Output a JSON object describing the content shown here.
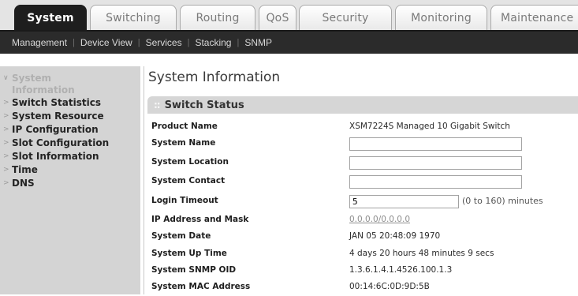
{
  "top_tabs": [
    {
      "label": "System",
      "active": true
    },
    {
      "label": "Switching",
      "active": false
    },
    {
      "label": "Routing",
      "active": false
    },
    {
      "label": "QoS",
      "active": false
    },
    {
      "label": "Security",
      "active": false
    },
    {
      "label": "Monitoring",
      "active": false
    },
    {
      "label": "Maintenance",
      "active": false
    }
  ],
  "sub_nav": [
    "Management",
    "Device View",
    "Services",
    "Stacking",
    "SNMP"
  ],
  "sidebar": {
    "items": [
      {
        "label": "System Information",
        "active": true
      },
      {
        "label": "Switch Statistics"
      },
      {
        "label": "System Resource"
      },
      {
        "label": "IP Configuration"
      },
      {
        "label": "Slot Configuration"
      },
      {
        "label": "Slot Information"
      },
      {
        "label": "Time"
      },
      {
        "label": "DNS"
      }
    ]
  },
  "page_title": "System Information",
  "section_title": "Switch Status",
  "fields": {
    "product_name": {
      "label": "Product Name",
      "value": "XSM7224S  Managed 10 Gigabit Switch"
    },
    "system_name": {
      "label": "System Name",
      "value": ""
    },
    "system_location": {
      "label": "System Location",
      "value": ""
    },
    "system_contact": {
      "label": "System Contact",
      "value": ""
    },
    "login_timeout": {
      "label": "Login Timeout",
      "value": "5",
      "hint": "(0 to 160) minutes"
    },
    "ip_address": {
      "label": "IP Address and Mask",
      "value": "0.0.0.0/0.0.0.0"
    },
    "system_date": {
      "label": "System Date",
      "value": "JAN 05 20:48:09 1970"
    },
    "uptime": {
      "label": "System Up Time",
      "value": "4 days 20 hours 48 minutes 9 secs"
    },
    "snmp_oid": {
      "label": "System SNMP OID",
      "value": "1.3.6.1.4.1.4526.100.1.3"
    },
    "mac_address": {
      "label": "System MAC Address",
      "value": "00:14:6C:0D:9D:5B"
    }
  }
}
